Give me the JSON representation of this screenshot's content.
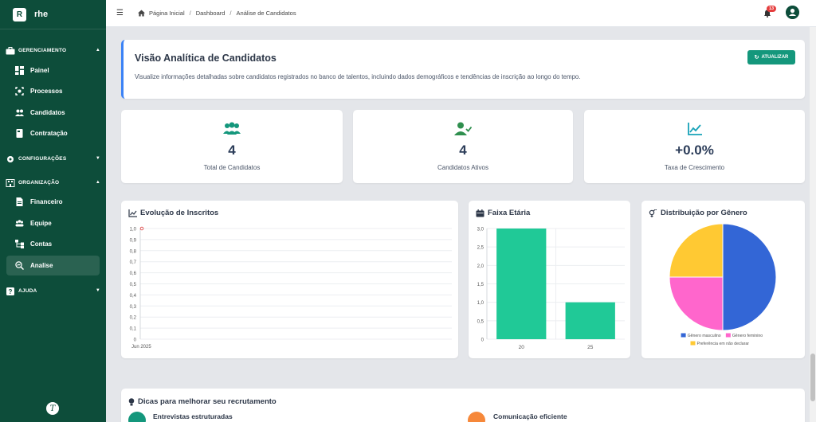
{
  "brand": {
    "logo_letter": "R",
    "name": "rhe"
  },
  "sidebar": {
    "sections": [
      {
        "label": "GERENCIAMENTO",
        "icon": "briefcase-icon",
        "expanded": true
      },
      {
        "label": "CONFIGURAÇÕES",
        "icon": "gear-icon",
        "expanded": false
      },
      {
        "label": "ORGANIZAÇÃO",
        "icon": "building-icon",
        "expanded": true
      },
      {
        "label": "AJUDA",
        "icon": "question-icon",
        "expanded": false
      }
    ],
    "items": [
      {
        "label": "Painel",
        "icon": "dashboard-icon"
      },
      {
        "label": "Processos",
        "icon": "process-icon"
      },
      {
        "label": "Candidatos",
        "icon": "users-icon"
      },
      {
        "label": "Contratação",
        "icon": "document-icon"
      },
      {
        "label": "Financeiro",
        "icon": "file-invoice-icon"
      },
      {
        "label": "Equipe",
        "icon": "team-icon"
      },
      {
        "label": "Contas",
        "icon": "sitemap-icon"
      },
      {
        "label": "Analise",
        "icon": "search-chart-icon",
        "active": true
      }
    ],
    "footer_logo": "T"
  },
  "topbar": {
    "breadcrumbs": [
      "Página Inicial",
      "Dashboard",
      "Análise de Candidatos"
    ],
    "notifications_count": "13"
  },
  "hero": {
    "title": "Visão Analítica de Candidatos",
    "description": "Visualize informações detalhadas sobre candidatos registrados no banco de talentos, incluindo dados demográficos e tendências de inscrição ao longo do tempo.",
    "refresh_label": "ATUALIZAR"
  },
  "stats": [
    {
      "value": "4",
      "label": "Total de Candidatos",
      "icon": "users-icon",
      "color": "#14977c"
    },
    {
      "value": "4",
      "label": "Candidatos Ativos",
      "icon": "user-check-icon",
      "color": "#2f8f4e"
    },
    {
      "value": "+0.0%",
      "label": "Taxa de Crescimento",
      "icon": "chart-line-icon",
      "color": "#17a2b8"
    }
  ],
  "charts": {
    "evolucao_title": "Evolução de Inscritos",
    "faixa_title": "Faixa Etária",
    "genero_title": "Distribuição por Gênero"
  },
  "chart_data": [
    {
      "type": "line",
      "title": "Evolução de Inscritos",
      "x": [
        "Jun 2025"
      ],
      "series": [
        {
          "values": [
            1.0
          ]
        }
      ],
      "y_ticks": [
        "1,0",
        "0,9",
        "0,8",
        "0,7",
        "0,6",
        "0,5",
        "0,4",
        "0,3",
        "0,2",
        "0,1",
        "0"
      ],
      "ylim": [
        0,
        1
      ],
      "color": "#e05a5a",
      "grid": true
    },
    {
      "type": "bar",
      "title": "Faixa Etária",
      "categories": [
        "20",
        "25"
      ],
      "values": [
        3,
        1
      ],
      "y_ticks": [
        "3,0",
        "2,5",
        "2,0",
        "1,5",
        "1,0",
        "0,5",
        "0"
      ],
      "ylim": [
        0,
        3
      ],
      "color": "#20c997",
      "grid": true
    },
    {
      "type": "pie",
      "title": "Distribuição por Gênero",
      "slices": [
        {
          "label": "Gênero masculino",
          "value": 2,
          "color": "#3366d6"
        },
        {
          "label": "Gênero feminino",
          "value": 1,
          "color": "#ff66cc"
        },
        {
          "label": "Preferência em não declarar",
          "value": 1,
          "color": "#ffc933"
        }
      ],
      "legend": "bottom"
    }
  ],
  "tips": {
    "title": "Dicas para melhorar seu recrutamento",
    "items": [
      {
        "label": "Entrevistas estruturadas",
        "color": "#14977c"
      },
      {
        "label": "Comunicação eficiente",
        "color": "#f6883a"
      }
    ]
  }
}
